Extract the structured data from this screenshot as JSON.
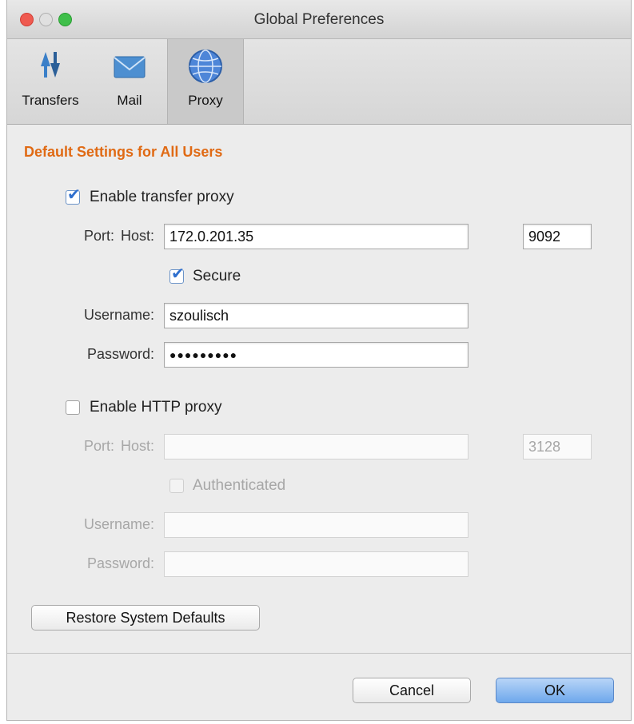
{
  "window": {
    "title": "Global Preferences"
  },
  "toolbar": {
    "items": [
      {
        "label": "Transfers",
        "icon": "transfer-arrows-icon"
      },
      {
        "label": "Mail",
        "icon": "mail-envelope-icon"
      },
      {
        "label": "Proxy",
        "icon": "globe-icon",
        "selected": true
      }
    ]
  },
  "section": {
    "title": "Default Settings for All Users"
  },
  "transfer_proxy": {
    "enable_label": "Enable transfer proxy",
    "enabled": true,
    "host_label": "Host:",
    "host": "172.0.201.35",
    "port_label": "Port:",
    "port": "9092",
    "secure_label": "Secure",
    "secure": true,
    "username_label": "Username:",
    "username": "szoulisch",
    "password_label": "Password:",
    "password": "●●●●●●●●●"
  },
  "http_proxy": {
    "enable_label": "Enable HTTP proxy",
    "enabled": false,
    "host_label": "Host:",
    "host": "",
    "port_label": "Port:",
    "port": "3128",
    "auth_label": "Authenticated",
    "username_label": "Username:",
    "username": "",
    "password_label": "Password:",
    "password": ""
  },
  "buttons": {
    "restore": "Restore System Defaults",
    "cancel": "Cancel",
    "ok": "OK"
  },
  "colors": {
    "section_title": "#e06a14",
    "checkbox": "#2f6fce",
    "ok_button": "#6ea8ec"
  }
}
